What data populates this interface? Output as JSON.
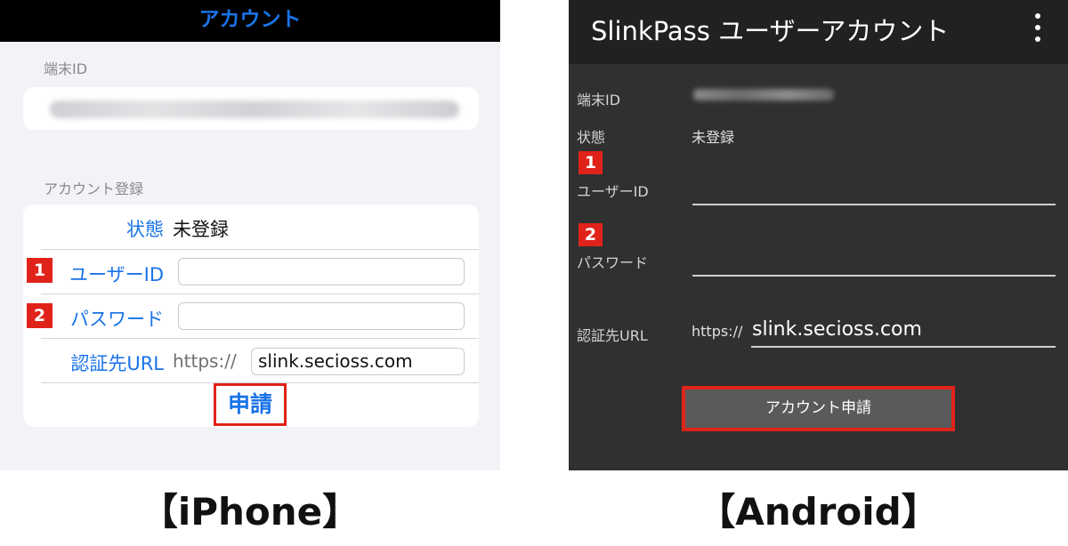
{
  "iphone": {
    "nav_title": "アカウント",
    "device_id_header": "端末ID",
    "account_header": "アカウント登録",
    "status_label": "状態",
    "status_value": "未登録",
    "userid_label": "ユーザーID",
    "password_label": "パスワード",
    "url_label": "認証先URL",
    "url_prefix": "https://",
    "url_value": "slink.secioss.com",
    "apply_label": "申請",
    "caption": "【iPhone】"
  },
  "android": {
    "app_title": "SlinkPass ユーザーアカウント",
    "device_id_label": "端末ID",
    "status_label": "状態",
    "status_value": "未登録",
    "userid_label": "ユーザーID",
    "password_label": "パスワード",
    "url_label": "認証先URL",
    "url_prefix": "https://",
    "url_value": "slink.secioss.com",
    "apply_label": "アカウント申請",
    "caption": "【Android】"
  },
  "badges": {
    "step1": "1",
    "step2": "2"
  },
  "colors": {
    "ios_accent": "#1a73e8",
    "highlight_red": "#e0231a",
    "android_bg": "#303030",
    "android_appbar": "#212121"
  },
  "icons": {
    "android_menu": "overflow-menu-icon"
  }
}
